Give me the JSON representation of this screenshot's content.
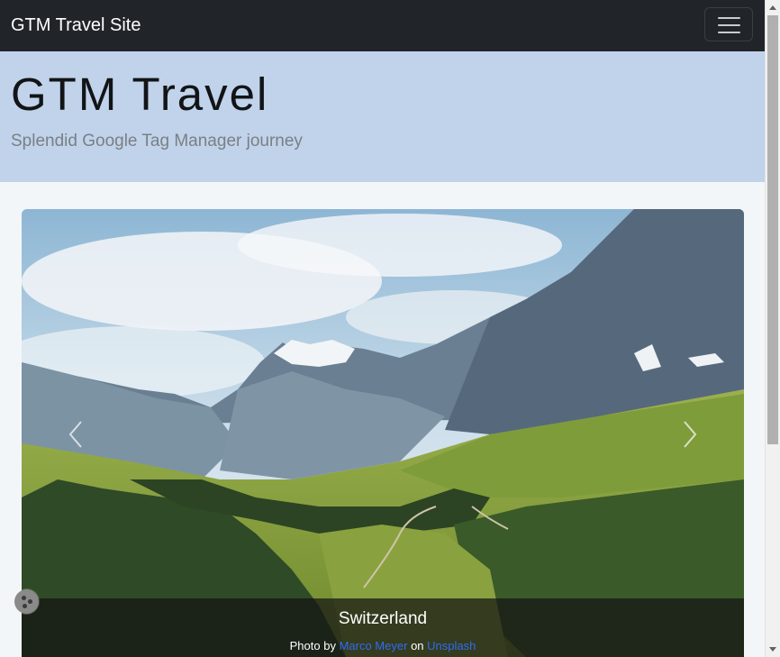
{
  "navbar": {
    "brand": "GTM Travel Site",
    "toggler_icon": "hamburger-menu-icon",
    "background": "#212529"
  },
  "hero": {
    "title": "GTM Travel",
    "subtitle": "Splendid Google Tag Manager journey",
    "background": "#c0d3ea"
  },
  "carousel": {
    "caption_title": "Switzerland",
    "credit_prefix": "Photo by",
    "credit_author": "Marco Meyer",
    "credit_mid": "on",
    "credit_source": "Unsplash",
    "prev_icon": "chevron-left-icon",
    "next_icon": "chevron-right-icon",
    "link_color": "#2f6cf0"
  },
  "cookie_widget": {
    "icon": "cookie-icon"
  }
}
